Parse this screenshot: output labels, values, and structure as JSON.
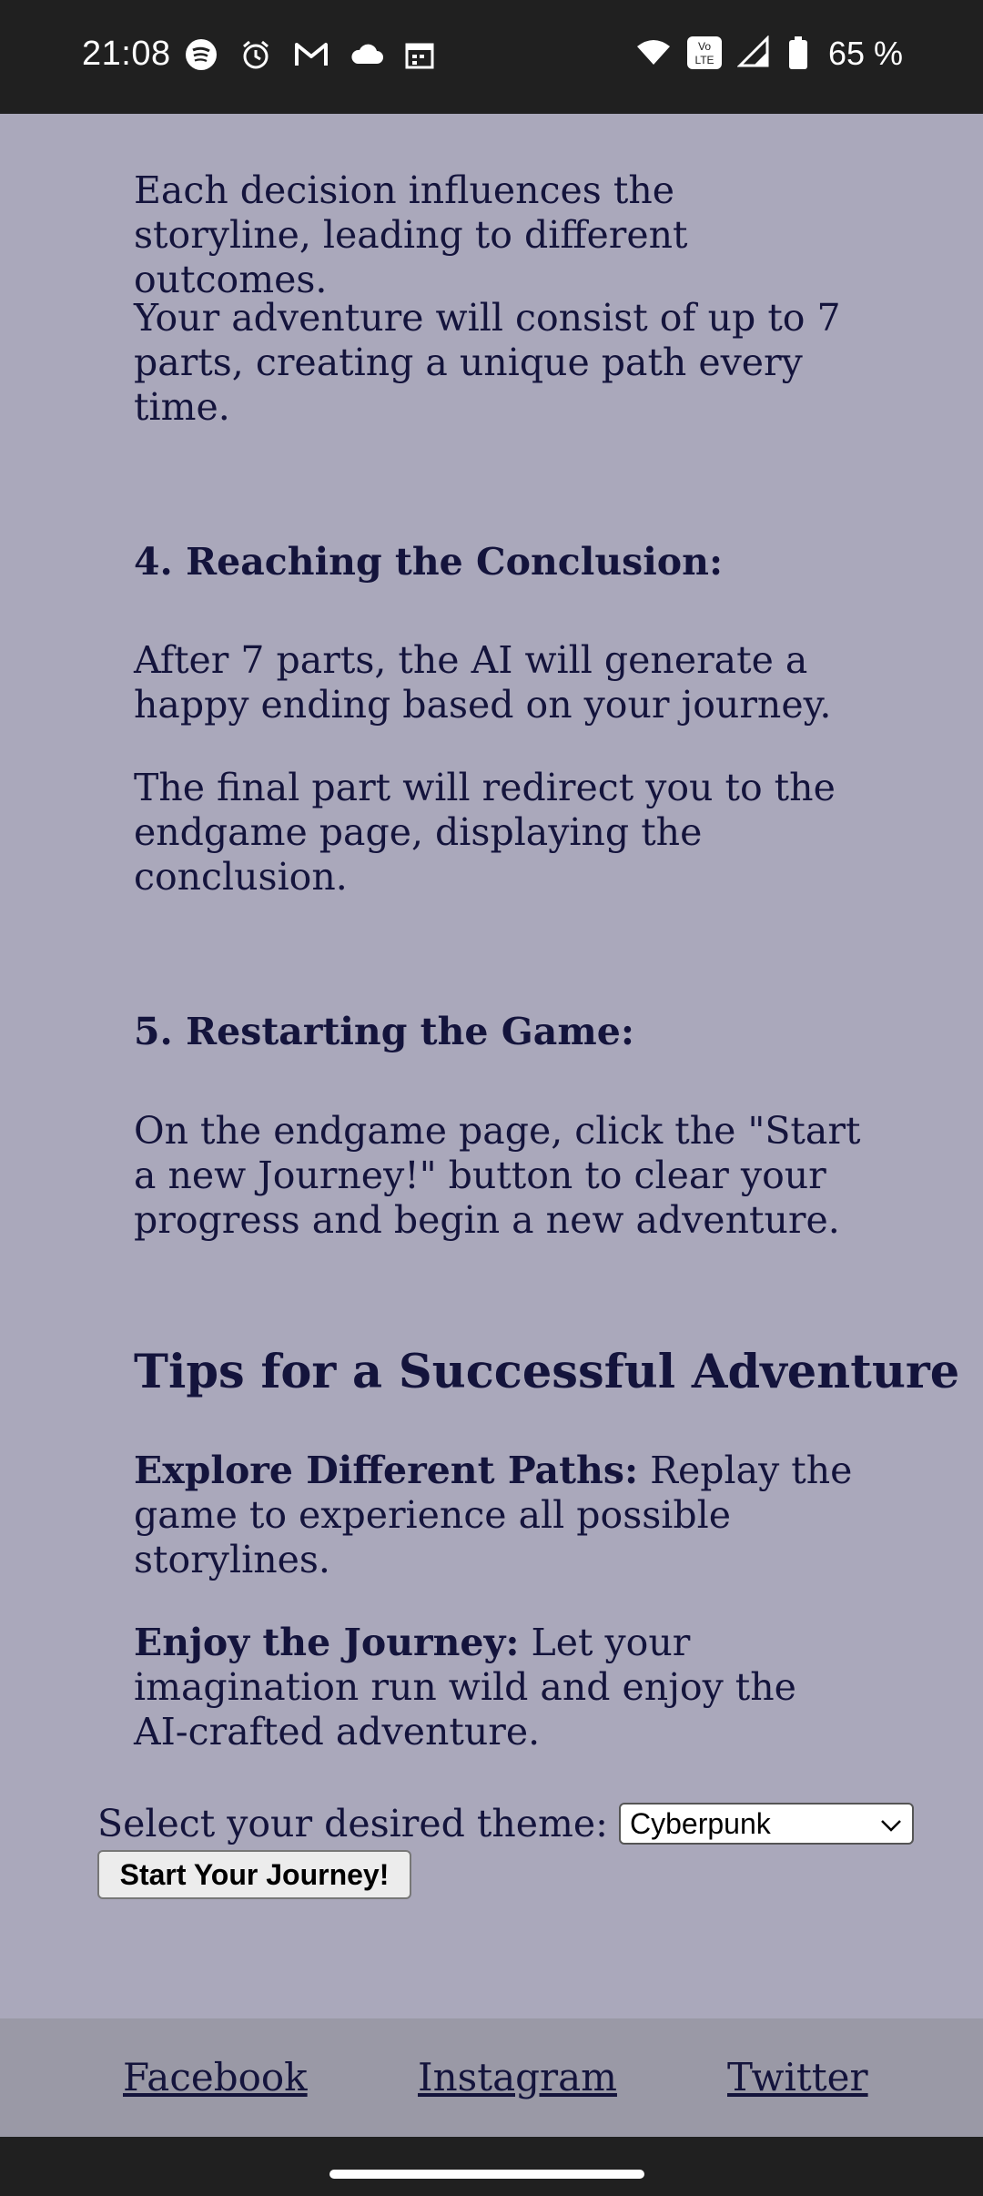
{
  "status_bar": {
    "time": "21:08",
    "left_icons": [
      "spotify-icon",
      "alarm-icon",
      "gmail-icon",
      "cloud-icon",
      "calendar-icon"
    ],
    "right_icons": [
      "wifi-icon",
      "volte-icon",
      "signal-icon",
      "battery-icon"
    ],
    "volte_label": "Vo LTE",
    "battery_percent": "65 %"
  },
  "content": {
    "para_decision": "Each decision influences the storyline, leading to different outcomes.",
    "para_parts": "Your adventure will consist of up to 7 parts, creating a unique path every time.",
    "step4_heading": "4. Reaching the Conclusion:",
    "step4_para1": "After 7 parts, the AI will generate a happy ending based on your journey.",
    "step4_para2": "The final part will redirect you to the endgame page, displaying the conclusion.",
    "step5_heading": "5. Restarting the Game:",
    "step5_para": "On the endgame page, click the \"Start a new Journey!\" button to clear your progress and begin a new adventure.",
    "tips_heading": "Tips for a Successful Adventure",
    "tip1_bold": "Explore Different Paths:",
    "tip1_text": " Replay the game to experience all possible storylines.",
    "tip2_bold": "Enjoy the Journey:",
    "tip2_text": " Let your imagination run wild and enjoy the AI-crafted adventure."
  },
  "form": {
    "theme_label": "Select your desired theme:",
    "theme_value": "Cyberpunk",
    "start_button": "Start Your Journey!"
  },
  "footer": {
    "facebook": "Facebook",
    "instagram": "Instagram",
    "twitter": "Twitter"
  },
  "colors": {
    "page_background": "#aaa8bb",
    "text": "#14143c",
    "footer_background": "#9a99a6",
    "system_bar": "#202020"
  }
}
